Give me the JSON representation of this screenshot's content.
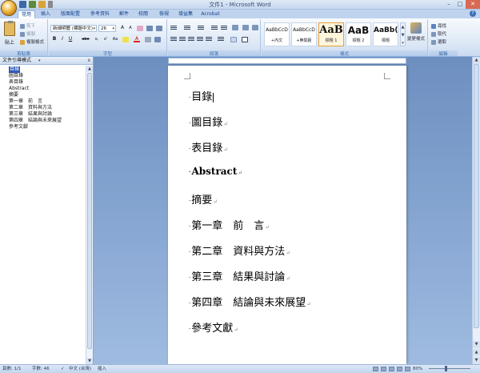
{
  "window": {
    "title": "文件1 - Microsoft Word",
    "minimize": "–",
    "maximize": "□",
    "close": "✕"
  },
  "tabs": [
    "常用",
    "插入",
    "版面配置",
    "參考資料",
    "郵件",
    "校閱",
    "檢視",
    "增益集",
    "Acrobat"
  ],
  "active_tab": "常用",
  "ribbon": {
    "clipboard": {
      "paste": "貼上",
      "cut": "剪下",
      "copy": "複製",
      "format_painter": "複製格式",
      "label": "剪貼簿"
    },
    "font": {
      "font_name": "新細明體 (標題中文)",
      "font_size": "26",
      "grow": "A",
      "shrink": "A",
      "clear": "A",
      "bold": "B",
      "italic": "I",
      "underline": "U",
      "strike": "abe",
      "subscript": "x,",
      "superscript": "x'",
      "change_case": "Aa",
      "font_color": "A",
      "label": "字型"
    },
    "paragraph": {
      "label": "段落"
    },
    "styles": {
      "label": "樣式",
      "items": [
        {
          "sample": "AaBbCcD",
          "name": "+內文"
        },
        {
          "sample": "AaBbCcD",
          "name": "+無間距"
        },
        {
          "sample": "AaB",
          "name": "標題 1"
        },
        {
          "sample": "AaB",
          "name": "標題 2"
        },
        {
          "sample": "AaBb(",
          "name": "標題"
        }
      ],
      "change_styles": "變更樣式"
    },
    "editing": {
      "label": "編輯",
      "find": "尋找",
      "replace": "取代",
      "select": "選取"
    }
  },
  "navpane": {
    "title": "文件引導模式",
    "close": "x",
    "items": [
      "目錄",
      "圖目錄",
      "表目錄",
      "Abstract",
      "摘要",
      "第一章　前　言",
      "第二章　資料與方法",
      "第三章　結果與討論",
      "第四章　結論與未來展望",
      "參考文獻"
    ],
    "selected_index": 0
  },
  "document": {
    "headings": [
      {
        "text": "目錄",
        "mark": ""
      },
      {
        "text": "圖目錄",
        "mark": "↵"
      },
      {
        "text": "表目錄",
        "mark": "↵"
      },
      {
        "text": "Abstract",
        "mark": "↵"
      },
      {
        "text": "摘要",
        "mark": "↵"
      },
      {
        "text": "第一章　前　言",
        "mark": "↵"
      },
      {
        "text": "第二章　資料與方法",
        "mark": "↵"
      },
      {
        "text": "第三章　結果與討論",
        "mark": "↵"
      },
      {
        "text": "第四章　結論與未來展望",
        "mark": "↵"
      },
      {
        "text": "參考文獻",
        "mark": "↵"
      }
    ]
  },
  "statusbar": {
    "page": "頁數: 1/1",
    "words": "字數: 46",
    "language": "中文 (台灣)",
    "mode": "插入",
    "zoom": "80%"
  }
}
